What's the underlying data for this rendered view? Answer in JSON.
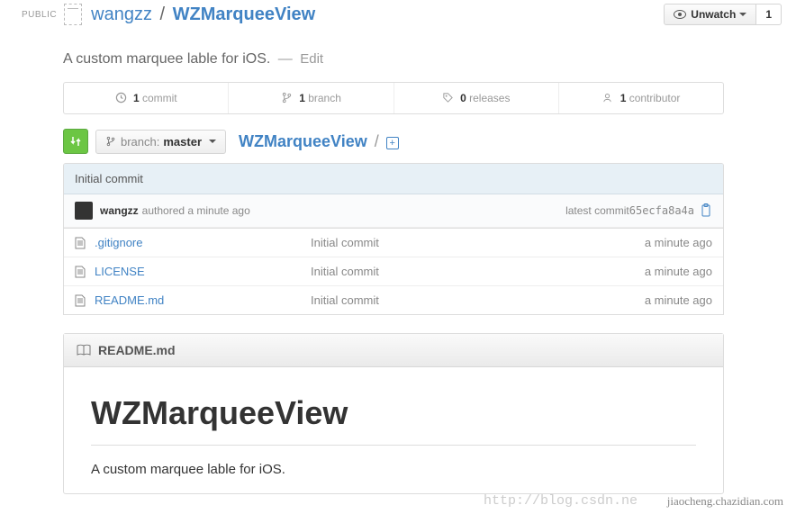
{
  "header": {
    "public_label": "PUBLIC",
    "owner": "wangzz",
    "separator": "/",
    "repo": "WZMarqueeView",
    "unwatch_label": "Unwatch",
    "watch_count": "1"
  },
  "description": {
    "text": "A custom marquee lable for iOS.",
    "dash": "—",
    "edit_label": "Edit"
  },
  "stats": {
    "commits": {
      "count": "1",
      "label": " commit"
    },
    "branches": {
      "count": "1",
      "label": " branch"
    },
    "releases": {
      "count": "0",
      "label": " releases"
    },
    "contributors": {
      "count": "1",
      "label": " contributor"
    }
  },
  "branch": {
    "prefix_icon": "git-branch-icon",
    "label": "branch:",
    "value": "master",
    "breadcrumb_root": "WZMarqueeView",
    "breadcrumb_sep": "/",
    "add_icon": "+"
  },
  "last_commit": {
    "message": "Initial commit",
    "author": "wangzz",
    "action": "authored a minute ago",
    "latest_label": "latest commit ",
    "hash": "65ecfa8a4a"
  },
  "files": [
    {
      "name": ".gitignore",
      "message": "Initial commit",
      "time": "a minute ago"
    },
    {
      "name": "LICENSE",
      "message": "Initial commit",
      "time": "a minute ago"
    },
    {
      "name": "README.md",
      "message": "Initial commit",
      "time": "a minute ago"
    }
  ],
  "readme": {
    "filename": "README.md",
    "title": "WZMarqueeView",
    "body": "A custom marquee lable for iOS."
  },
  "watermarks": {
    "left": "http://blog.csdn.ne",
    "right": "jiaocheng.chazidian.com"
  }
}
